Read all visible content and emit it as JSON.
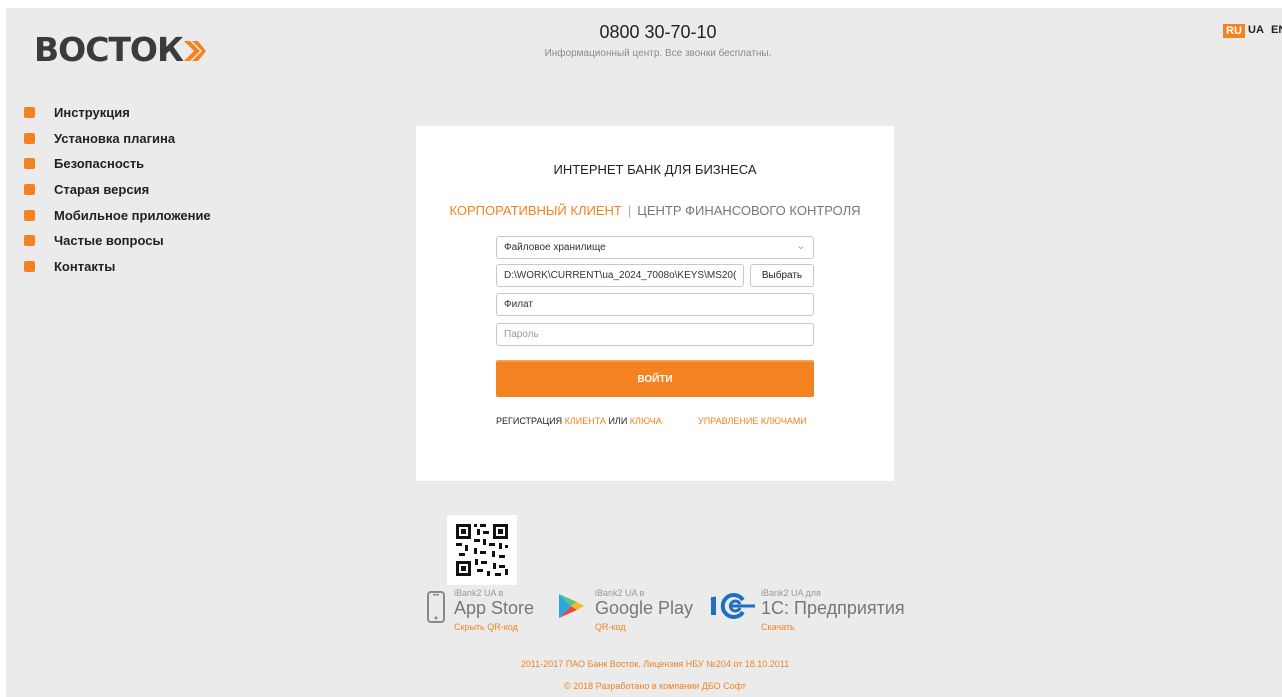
{
  "header": {
    "logo": "ВОСТОК",
    "phone": "0800 30-70-10",
    "phone_sub": "Информационный центр. Все звонки бесплатны."
  },
  "languages": [
    {
      "label": "RU",
      "active": true
    },
    {
      "label": "UA",
      "active": false
    },
    {
      "label": "EN",
      "active": false
    }
  ],
  "sidebar": {
    "items": [
      {
        "label": "Инструкция"
      },
      {
        "label": "Установка плагина"
      },
      {
        "label": "Безопасность"
      },
      {
        "label": "Старая версия"
      },
      {
        "label": "Мобильное приложение"
      },
      {
        "label": "Частые вопросы"
      },
      {
        "label": "Контакты"
      }
    ]
  },
  "login": {
    "title": "ИНТЕРНЕТ БАНК ДЛЯ БИЗНЕСА",
    "tab_active": "КОРПОРАТИВНЫЙ КЛИЕНТ",
    "tab_other": "ЦЕНТР ФИНАНСОВОГО КОНТРОЛЯ",
    "storage_select": "Файловое хранилище",
    "key_path": "D:\\WORK\\CURRENT\\ua_2024_7008o\\KEYS\\MS20(",
    "browse_label": "Выбрать",
    "key_name": "Филат",
    "password_placeholder": "Пароль",
    "submit_label": "ВОЙТИ",
    "register_prefix": "РЕГИСТРАЦИЯ",
    "register_client": "КЛИЕНТА",
    "register_or": "ИЛИ",
    "register_key": "КЛЮЧА",
    "manage_keys": "УПРАВЛЕНИЕ КЛЮЧАМИ"
  },
  "stores": [
    {
      "small": "iBank2 UA в",
      "big": "App Store",
      "link": "Скрыть QR-код",
      "icon": "phone-icon"
    },
    {
      "small": "iBank2 UA в",
      "big": "Google Play",
      "link": "QR-код",
      "icon": "google-play-icon"
    },
    {
      "small": "iBank2 UA для",
      "big": "1С: Предприятия",
      "link": "Скачать",
      "icon": "1c-logo-icon"
    }
  ],
  "footer": {
    "line1": "2011-2017 ПАО Банк Восток. Лицензия НБУ №204 от 18.10.2011",
    "line2": "© 2018 Разработано в компании ДБО Софт"
  },
  "colors": {
    "accent": "#f58220",
    "background": "#ebebeb"
  }
}
